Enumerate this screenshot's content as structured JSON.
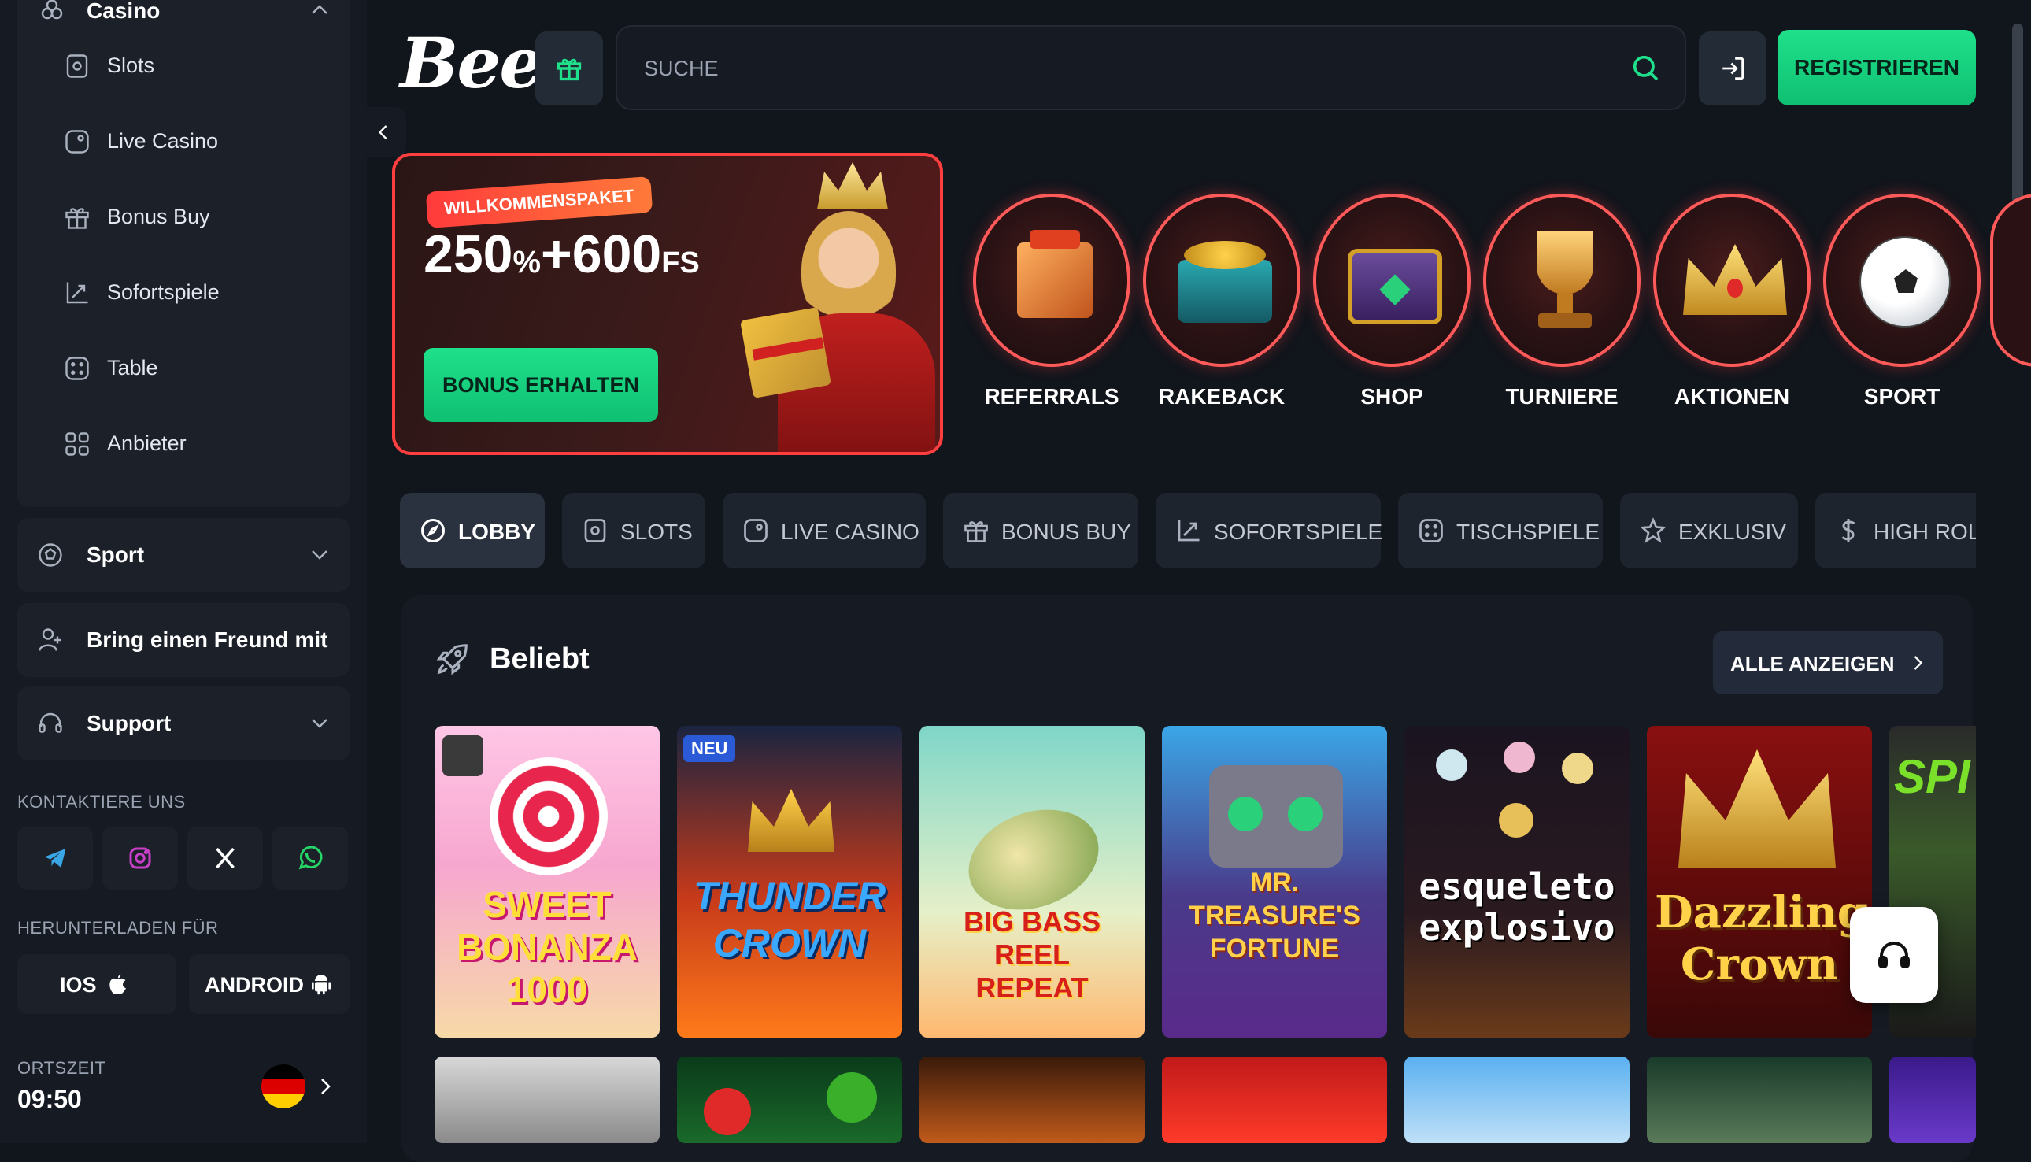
{
  "sidebar": {
    "casino_label": "Casino",
    "casino_items": [
      {
        "label": "Slots",
        "icon": "slots-icon"
      },
      {
        "label": "Live Casino",
        "icon": "live-casino-icon"
      },
      {
        "label": "Bonus Buy",
        "icon": "gift-icon"
      },
      {
        "label": "Sofortspiele",
        "icon": "instant-games-icon"
      },
      {
        "label": "Table",
        "icon": "dice-icon"
      },
      {
        "label": "Anbieter",
        "icon": "grid-icon"
      }
    ],
    "sport_label": "Sport",
    "friend_label": "Bring einen Freund mit",
    "support_label": "Support",
    "contact_heading": "KONTAKTIERE UNS",
    "download_heading": "HERUNTERLADEN FÜR",
    "ios_label": "IOS",
    "android_label": "ANDROID",
    "time_label": "ORTSZEIT",
    "time_value": "09:50"
  },
  "header": {
    "logo": "Beef",
    "search_placeholder": "SUCHE",
    "register_label": "REGISTRIEREN"
  },
  "banner": {
    "tag": "WILLKOMMENSPAKET",
    "offer_main": "250",
    "offer_pct": "%",
    "offer_plus": "+600",
    "offer_fs": "FS",
    "cta": "BONUS ERHALTEN"
  },
  "categories": [
    {
      "label": "REFERRALS"
    },
    {
      "label": "RAKEBACK"
    },
    {
      "label": "SHOP"
    },
    {
      "label": "TURNIERE"
    },
    {
      "label": "AKTIONEN"
    },
    {
      "label": "SPORT"
    }
  ],
  "tabs": [
    {
      "label": "LOBBY",
      "icon": "compass-icon",
      "active": true
    },
    {
      "label": "SLOTS",
      "icon": "slots-icon"
    },
    {
      "label": "LIVE CASINO",
      "icon": "live-casino-icon"
    },
    {
      "label": "BONUS BUY",
      "icon": "gift-icon"
    },
    {
      "label": "SOFORTSPIELE",
      "icon": "instant-games-icon"
    },
    {
      "label": "TISCHSPIELE",
      "icon": "dice-icon"
    },
    {
      "label": "EXKLUSIV",
      "icon": "star-icon"
    },
    {
      "label": "HIGH ROLL",
      "icon": "dollar-icon"
    }
  ],
  "popular": {
    "heading": "Beliebt",
    "view_all": "ALLE ANZEIGEN",
    "games": [
      {
        "title": "SWEET BONANZA 1000",
        "badge": ""
      },
      {
        "title": "THUNDER CROWN",
        "badge": "NEU"
      },
      {
        "title": "BIG BASS REEL REPEAT",
        "badge": ""
      },
      {
        "title": "MR. TREASURE'S FORTUNE",
        "badge": ""
      },
      {
        "title": "esqueleto explosivo",
        "badge": ""
      },
      {
        "title": "Dazzling Crown",
        "badge": ""
      }
    ]
  },
  "colors": {
    "accent_green": "#1fe08b",
    "promo_red": "#ff3f3f",
    "background": "#11151c"
  }
}
